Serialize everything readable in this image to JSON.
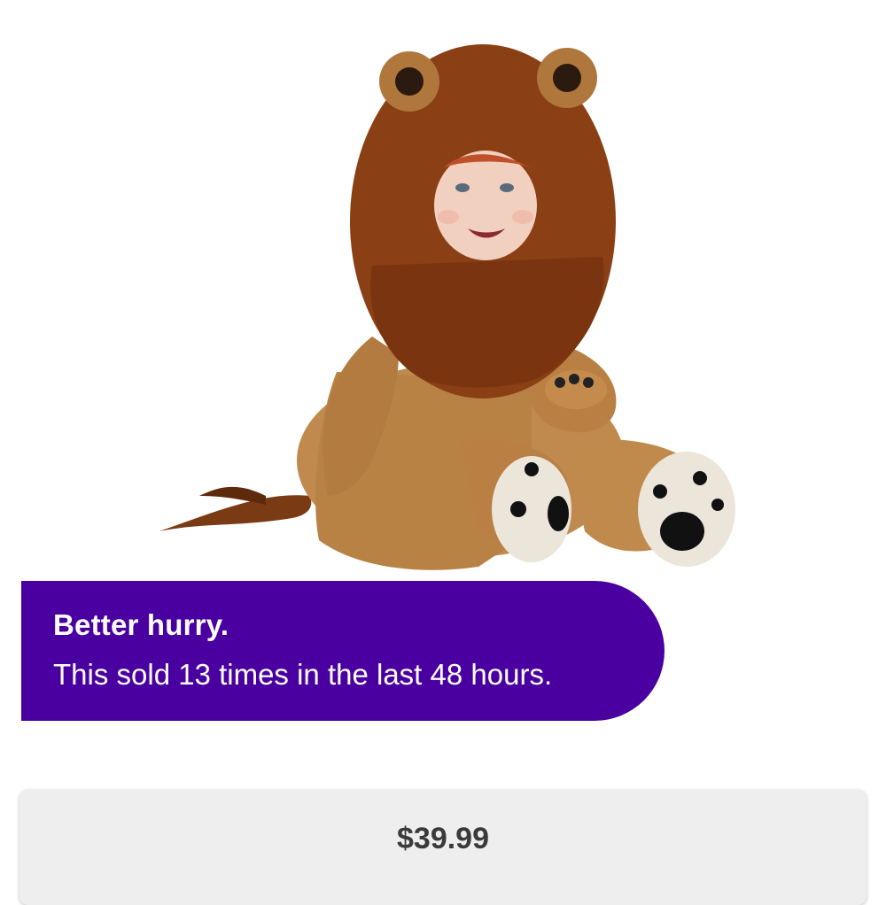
{
  "product": {
    "image": "lion-costume-toddler-photo"
  },
  "urgency_banner": {
    "title": "Better hurry.",
    "message": "This sold 13 times in the last 48 hours.",
    "background_color": "#4a00a0"
  },
  "price_card": {
    "price": "$39.99"
  }
}
